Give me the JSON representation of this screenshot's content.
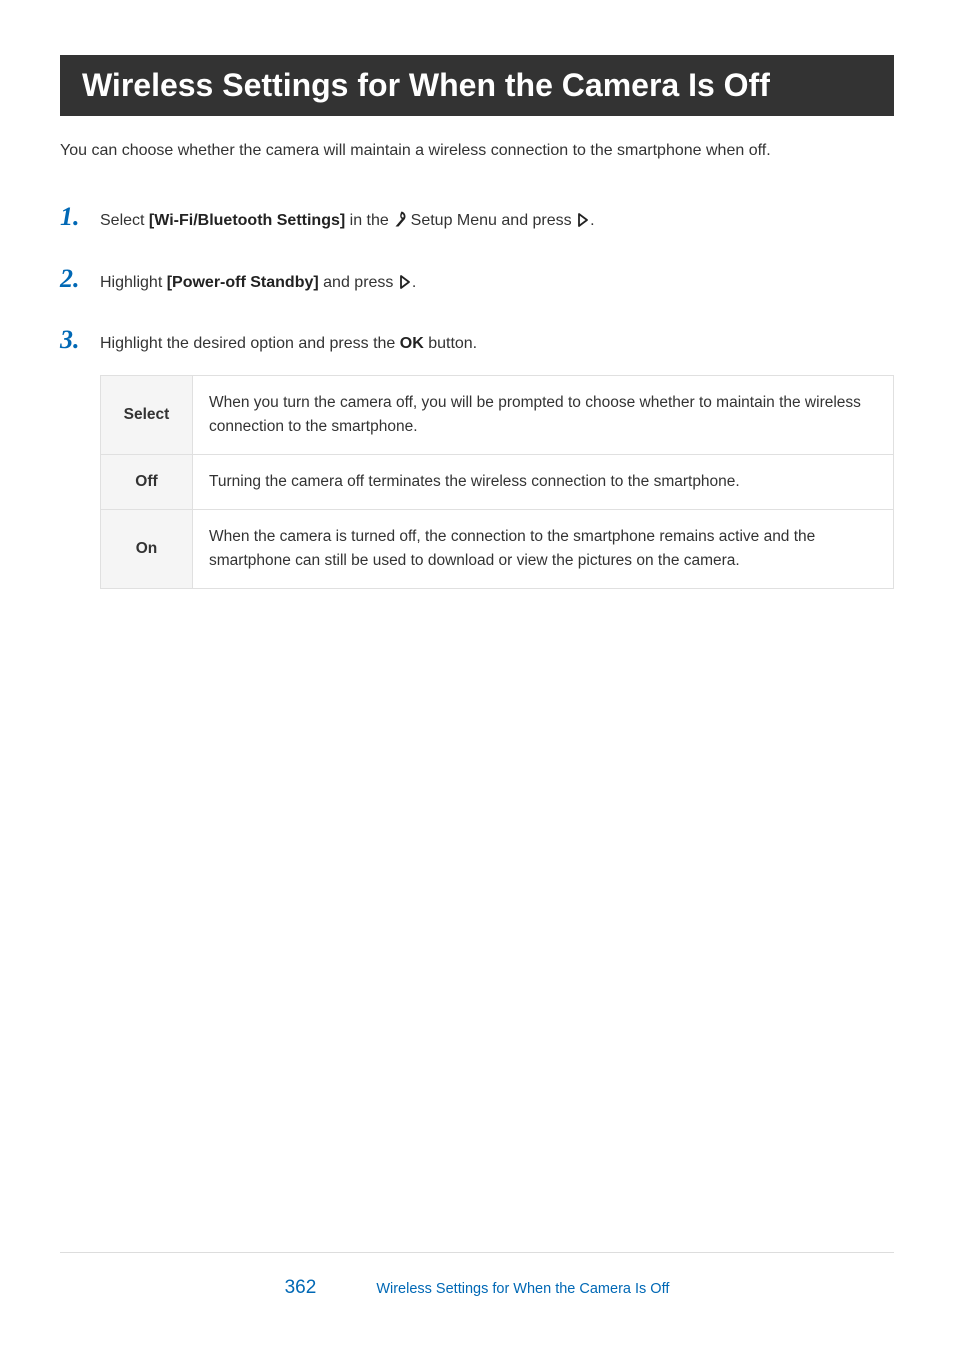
{
  "title": "Wireless Settings for When the Camera Is Off",
  "intro": "You can choose whether the camera will maintain a wireless connection to the smartphone when off.",
  "steps": {
    "s1": {
      "pre": "Select ",
      "bold": "[Wi-Fi/Bluetooth Settings]",
      "mid": " in the ",
      "post": " Setup Menu and press ",
      "end": "."
    },
    "s2": {
      "pre": "Highlight ",
      "bold": "[Power-off Standby]",
      "post": " and press ",
      "end": "."
    },
    "s3": {
      "pre": "Highlight the desired option and press the ",
      "bold": "OK",
      "post": " button."
    }
  },
  "nums": {
    "n1": "1.",
    "n2": "2.",
    "n3": "3."
  },
  "table": {
    "select": {
      "label": "Select",
      "desc": "When you turn the camera off, you will be prompted to choose whether to maintain the wireless connection to the smartphone."
    },
    "off": {
      "label": "Off",
      "desc": "Turning the camera off terminates the wireless connection to the smartphone."
    },
    "on": {
      "label": "On",
      "desc": "When the camera is turned off, the connection to the smartphone remains active and the smartphone can still be used to download or view the pictures on the camera."
    }
  },
  "footer": {
    "page": "362",
    "label": "Wireless Settings for When the Camera Is Off"
  }
}
